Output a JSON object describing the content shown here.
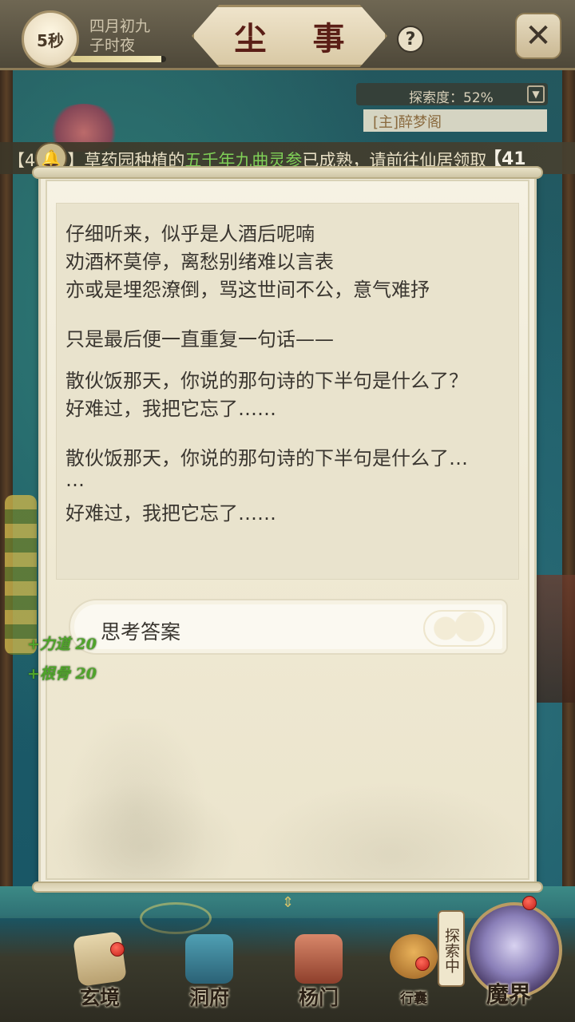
{
  "header": {
    "timer": "5秒",
    "date_line1": "四月初九",
    "date_line2": "子时夜",
    "time_progress": 0.95,
    "title": "尘 事",
    "help_label": "?",
    "close_label": "✕"
  },
  "explore": {
    "progress_text": "探索度：52%",
    "toggle_icon": "chevron-down-icon",
    "location": "[主]醉梦阁"
  },
  "notice": {
    "prefix": "【4",
    "bell_icon": "bell-icon",
    "mid": "】草药园种植的",
    "highlight": "五千年九曲灵参",
    "suffix": "已成熟，请前往仙居领取",
    "badge": "【41"
  },
  "story": {
    "lines": [
      "仔细听来，似乎是人酒后呢喃",
      "劝酒杯莫停，离愁别绪难以言表",
      "亦或是埋怨潦倒，骂这世间不公，意气难抒",
      "只是最后便一直重复一句话——",
      "散伙饭那天，你说的那句诗的下半句是什么了？",
      "好难过，我把它忘了……",
      "散伙饭那天，你说的那句诗的下半句是什么了…",
      "…",
      "好难过，我把它忘了……"
    ]
  },
  "answer": {
    "label": "思考答案"
  },
  "gains": [
    "+力道 20",
    "+根骨 20"
  ],
  "scroll_hint": "⇕",
  "nav": {
    "xuanjing": "玄境",
    "dongfu": "洞府",
    "yangmen": "杨门",
    "xingnang": "行囊",
    "explore_vertical": "探索中",
    "mojie": "魔界"
  },
  "colors": {
    "highlight_green": "#7fcf57",
    "gain_green": "#4fa42a",
    "title_red": "#5a1e16",
    "red_dot": "#c4201a"
  }
}
